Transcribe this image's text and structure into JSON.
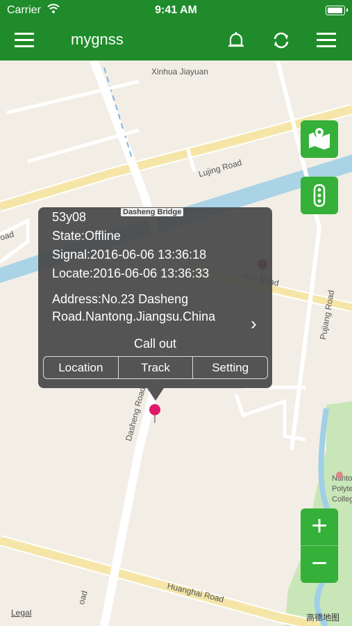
{
  "status_bar": {
    "carrier": "Carrier",
    "time": "9:41 AM"
  },
  "nav": {
    "title": "mygnss"
  },
  "map": {
    "labels": {
      "xinhua": "Xinhua Jiayuan",
      "lujing": "Lujing Road",
      "oad": "oad",
      "bridge": "Dasheng Bridge",
      "nan": "nan Road",
      "pujiang": "Pujiang Road",
      "dasheng_road": "Dasheng Road",
      "huanghai": "Huanghai Road",
      "nantong": "Nanton",
      "polytech": "Polytech",
      "college": "Colleg"
    },
    "legal": "Legal",
    "provider": "高德地图"
  },
  "popup": {
    "device": "53y08",
    "state": "State:Offline",
    "signal": "Signal:2016-06-06 13:36:18",
    "locate": "Locate:2016-06-06 13:36:33",
    "address_line1": "Address:No.23 Dasheng",
    "address_line2": "Road.Nantong.Jiangsu.China",
    "call_out": "Call out",
    "buttons": {
      "location": "Location",
      "track": "Track",
      "setting": "Setting"
    }
  },
  "zoom": {
    "in": "+",
    "out": "−"
  },
  "colors": {
    "header": "#1f8b2a",
    "button": "#35b038",
    "pin": "#e0196a"
  }
}
